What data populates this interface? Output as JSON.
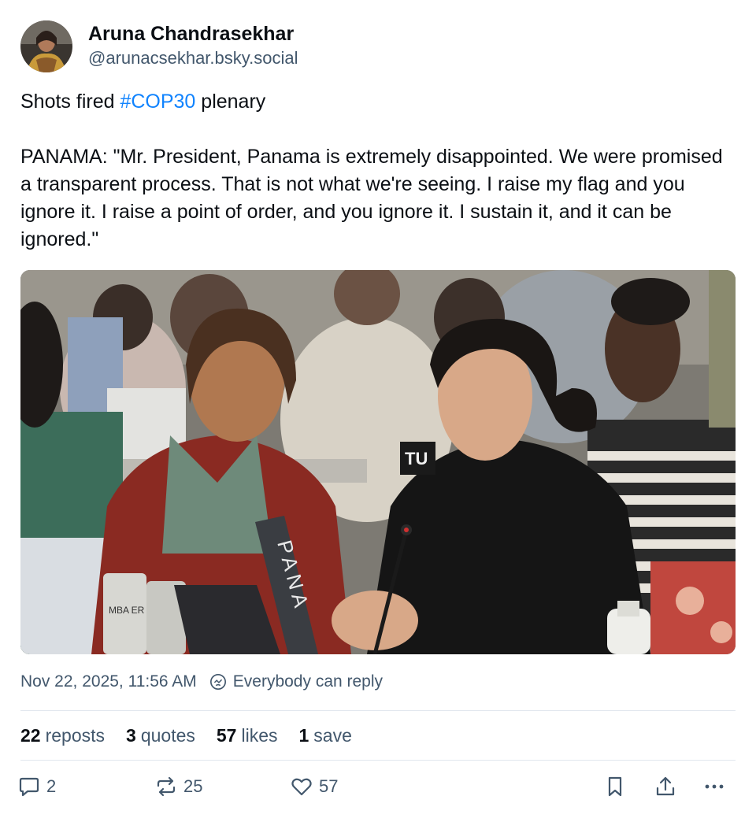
{
  "author": {
    "display_name": "Aruna Chandrasekhar",
    "handle": "@arunacsekhar.bsky.social"
  },
  "post": {
    "line1_before": "Shots fired ",
    "hashtag": "#COP30",
    "line1_after": " plenary",
    "quote": "PANAMA: \"Mr. President, Panama is extremely disappointed. We were promised a transparent process. That is not what we're seeing. I raise my flag and you ignore it. I raise a point of order, and you ignore it. I sustain it, and it can be ignored.\""
  },
  "image": {
    "sign_text": "PANA",
    "placard_text": "TU",
    "can_text": "MBA ER"
  },
  "meta": {
    "timestamp": "Nov 22, 2025, 11:56 AM",
    "reply_setting": "Everybody can reply"
  },
  "stats": {
    "reposts_count": "22",
    "reposts_label": "reposts",
    "quotes_count": "3",
    "quotes_label": "quotes",
    "likes_count": "57",
    "likes_label": "likes",
    "saves_count": "1",
    "saves_label": "save"
  },
  "actions": {
    "reply_count": "2",
    "repost_count": "25",
    "like_count": "57"
  },
  "colors": {
    "accent": "#1083fe",
    "muted_text": "#42576c",
    "divider": "#e2e7ee"
  },
  "icons": [
    "avatar",
    "globe-reply-icon",
    "comment-icon",
    "repost-icon",
    "heart-icon",
    "bookmark-icon",
    "share-icon",
    "more-icon"
  ]
}
